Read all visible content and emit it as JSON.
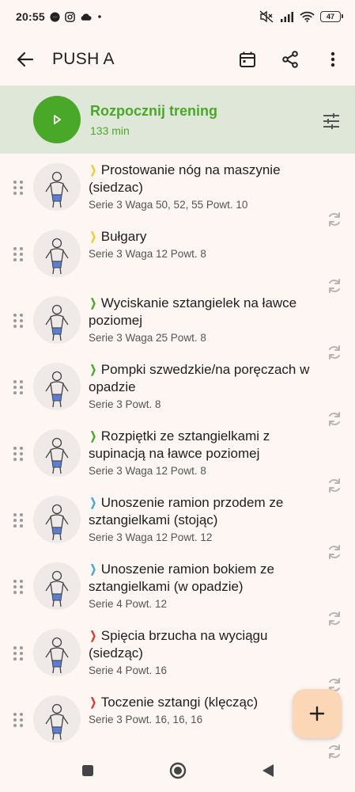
{
  "status_bar": {
    "time": "20:55",
    "battery": "47",
    "icons": [
      "messenger-icon",
      "instagram-icon",
      "cloud-icon",
      "dot-icon",
      "mute-icon",
      "signal-icon",
      "wifi-icon",
      "battery-icon"
    ]
  },
  "app_bar": {
    "title": "PUSH A",
    "icons": [
      "back-arrow-icon",
      "calendar-icon",
      "share-icon",
      "more-vert-icon"
    ]
  },
  "start_panel": {
    "title": "Rozpocznij trening",
    "duration": "133 min"
  },
  "colors": {
    "accent_green": "#4aa828",
    "panel_bg": "#dfe8d8",
    "chevron_yellow": "#f2cc2e",
    "chevron_green": "#4aa828",
    "chevron_blue": "#3aa9de",
    "chevron_red": "#e2382d",
    "fab_bg": "#fbd7b6"
  },
  "exercises": [
    {
      "name": "Prostowanie nóg na maszynie (siedzac)",
      "details": "Serie 3 Waga 50, 52, 55 Powt. 10",
      "chevron": "yellow"
    },
    {
      "name": "Bułgary",
      "details": "Serie 3 Waga 12 Powt. 8",
      "chevron": "yellow"
    },
    {
      "name": "Wyciskanie sztangielek na ławce poziomej",
      "details": "Serie 3 Waga 25 Powt. 8",
      "chevron": "green"
    },
    {
      "name": "Pompki szwedzkie/na poręczach w opadzie",
      "details": "Serie 3 Powt. 8",
      "chevron": "green"
    },
    {
      "name": "Rozpiętki ze sztangielkami z supinacją na ławce poziomej",
      "details": "Serie 3 Waga 12 Powt. 8",
      "chevron": "green"
    },
    {
      "name": "Unoszenie ramion przodem ze sztangielkami (stojąc)",
      "details": "Serie 3 Waga 12 Powt. 12",
      "chevron": "blue"
    },
    {
      "name": "Unoszenie ramion bokiem ze sztangielkami (w opadzie)",
      "details": "Serie 4 Powt. 12",
      "chevron": "blue"
    },
    {
      "name": "Spięcia brzucha na wyciągu (siedząc)",
      "details": "Serie 4 Powt. 16",
      "chevron": "red"
    },
    {
      "name": "Toczenie sztangi (klęcząc)",
      "details": "Serie 3 Powt. 16, 16, 16",
      "chevron": "red"
    }
  ],
  "fab": {
    "icon": "plus-icon"
  },
  "nav": {
    "icons": [
      "recents-square-icon",
      "home-circle-icon",
      "back-triangle-icon"
    ]
  }
}
